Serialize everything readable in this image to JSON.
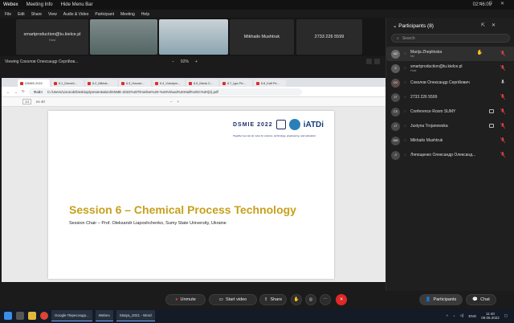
{
  "app": {
    "name": "Webex",
    "meeting_info": "Meeting Info",
    "hide_menu_bar": "Hide Menu Bar",
    "clock": "02:46:09"
  },
  "menu": [
    "File",
    "Edit",
    "Share",
    "View",
    "Audio & Video",
    "Participant",
    "Meeting",
    "Help"
  ],
  "video_tiles": [
    {
      "label": "smartproduction@tu.kielce.pl",
      "sub": "Host"
    },
    {
      "label": "",
      "sub": ""
    },
    {
      "label": "",
      "sub": ""
    },
    {
      "label": "Mikhailo Mushtruk",
      "sub": ""
    },
    {
      "label": "2733 226 5599",
      "sub": ""
    }
  ],
  "viewing": "Viewing Соколов Олександр Сергійов...",
  "zoom": {
    "minus": "−",
    "value": "92%",
    "plus": "+"
  },
  "browser": {
    "tabs": [
      "DSMIE-2022",
      "6.1_Demeti...",
      "6.2_Mikhai...",
      "6.3_Houser...",
      "6.4_Volodym...",
      "6.5_Maria C...",
      "6.7_Igor Pe...",
      "6.8_Kalf Pe..."
    ],
    "url": "C:/Users/Lisonok/Desktop/presentation/DSME-2022%20Timeline%20-%20Virtual%20Hall%20C%20(2).pdf",
    "url_prefix": "Файл",
    "page_current": "14",
    "page_total": "из 40"
  },
  "slide": {
    "logo_text": "DSMIE 2022",
    "iatdi": "iATDi",
    "tagline": "Together we can do more for science, technology, engineering, and education",
    "title": "Session 6 – Chemical Process Technology",
    "chair": "Session Chair – Prof. Oleksandr Liaposhchenko, Sumy State University, Ukraine"
  },
  "panel": {
    "title": "Participants (8)",
    "search_placeholder": "Search",
    "participants": [
      {
        "initials": "MZ",
        "name": "Marija Zheplinska",
        "sub": "Me",
        "hand": true,
        "cam": false,
        "mic_muted": true
      },
      {
        "initials": "S",
        "name": "smartproduction@tu.kielce.pl",
        "sub": "Host",
        "hand": false,
        "cam": false,
        "mic_muted": true
      },
      {
        "initials": "СО",
        "name": "Соколов Олександр Сергійович",
        "sub": "",
        "hand": false,
        "cam": false,
        "mic_muted": false
      },
      {
        "initials": "27",
        "name": "2733 226 5599",
        "sub": "",
        "hand": false,
        "cam": false,
        "mic_muted": true
      },
      {
        "initials": "CS",
        "name": "Conference Room SUMY",
        "sub": "",
        "hand": false,
        "cam": true,
        "mic_muted": true
      },
      {
        "initials": "JT",
        "name": "Justyna Trojanowska",
        "sub": "",
        "hand": false,
        "cam": true,
        "mic_muted": true
      },
      {
        "initials": "MM",
        "name": "Mikhailo Mushtruk",
        "sub": "",
        "hand": false,
        "cam": false,
        "mic_muted": true
      },
      {
        "initials": "Л",
        "name": "Ляпощенко Олександр Олександ...",
        "sub": "",
        "hand": false,
        "cam": false,
        "mic_muted": true
      }
    ]
  },
  "controls": {
    "unmute": "Unmute",
    "start_video": "Start video",
    "share": "Share",
    "participants": "Participants",
    "chat": "Chat"
  },
  "taskbar": {
    "apps": [
      "Google Переслада...",
      "Webex",
      "Statya_2021 - Word"
    ],
    "lang": "ENG",
    "time": "11:40",
    "date": "09.06.2022"
  },
  "colors": {
    "accent": "#c7a01c",
    "end": "#e02828",
    "muted": "#e04040"
  }
}
